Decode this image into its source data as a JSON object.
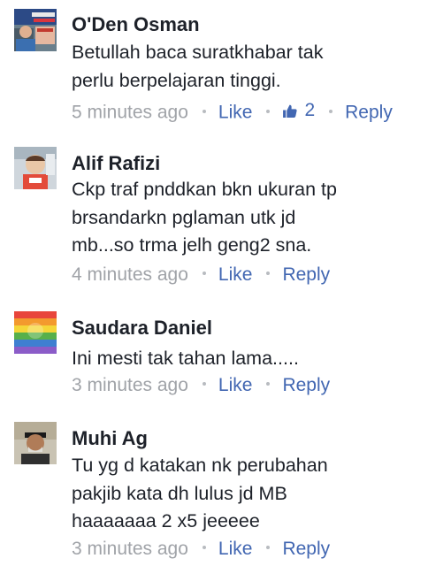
{
  "comments": [
    {
      "author": "O'Den Osman",
      "lines": [
        "Betullah baca suratkhabar tak",
        "perlu berpelajaran tinggi."
      ],
      "time": "5 minutes ago",
      "like_label": "Like",
      "like_count": "2",
      "reply_label": "Reply",
      "avatar_icon": "profile-photo-icon"
    },
    {
      "author": "Alif Rafizi",
      "lines": [
        "Ckp traf pnddkan bkn ukuran tp",
        "brsandarkn pglaman utk jd",
        "mb...so trma jelh geng2 sna."
      ],
      "time": "4 minutes ago",
      "like_label": "Like",
      "reply_label": "Reply",
      "avatar_icon": "profile-photo-icon"
    },
    {
      "author": "Saudara Daniel",
      "lines": [
        "Ini mesti tak tahan lama....."
      ],
      "time": "3 minutes ago",
      "like_label": "Like",
      "reply_label": "Reply",
      "avatar_icon": "rainbow-flag-icon"
    },
    {
      "author": "Muhi Ag",
      "lines": [
        "Tu yg d katakan nk perubahan",
        "pakjib kata dh lulus jd MB",
        "haaaaaaa 2 x5 jeeeee"
      ],
      "time": "3 minutes ago",
      "like_label": "Like",
      "reply_label": "Reply",
      "avatar_icon": "profile-photo-icon"
    }
  ],
  "colors": {
    "link": "#4267b2",
    "meta": "#90949c",
    "text": "#1d2129"
  }
}
